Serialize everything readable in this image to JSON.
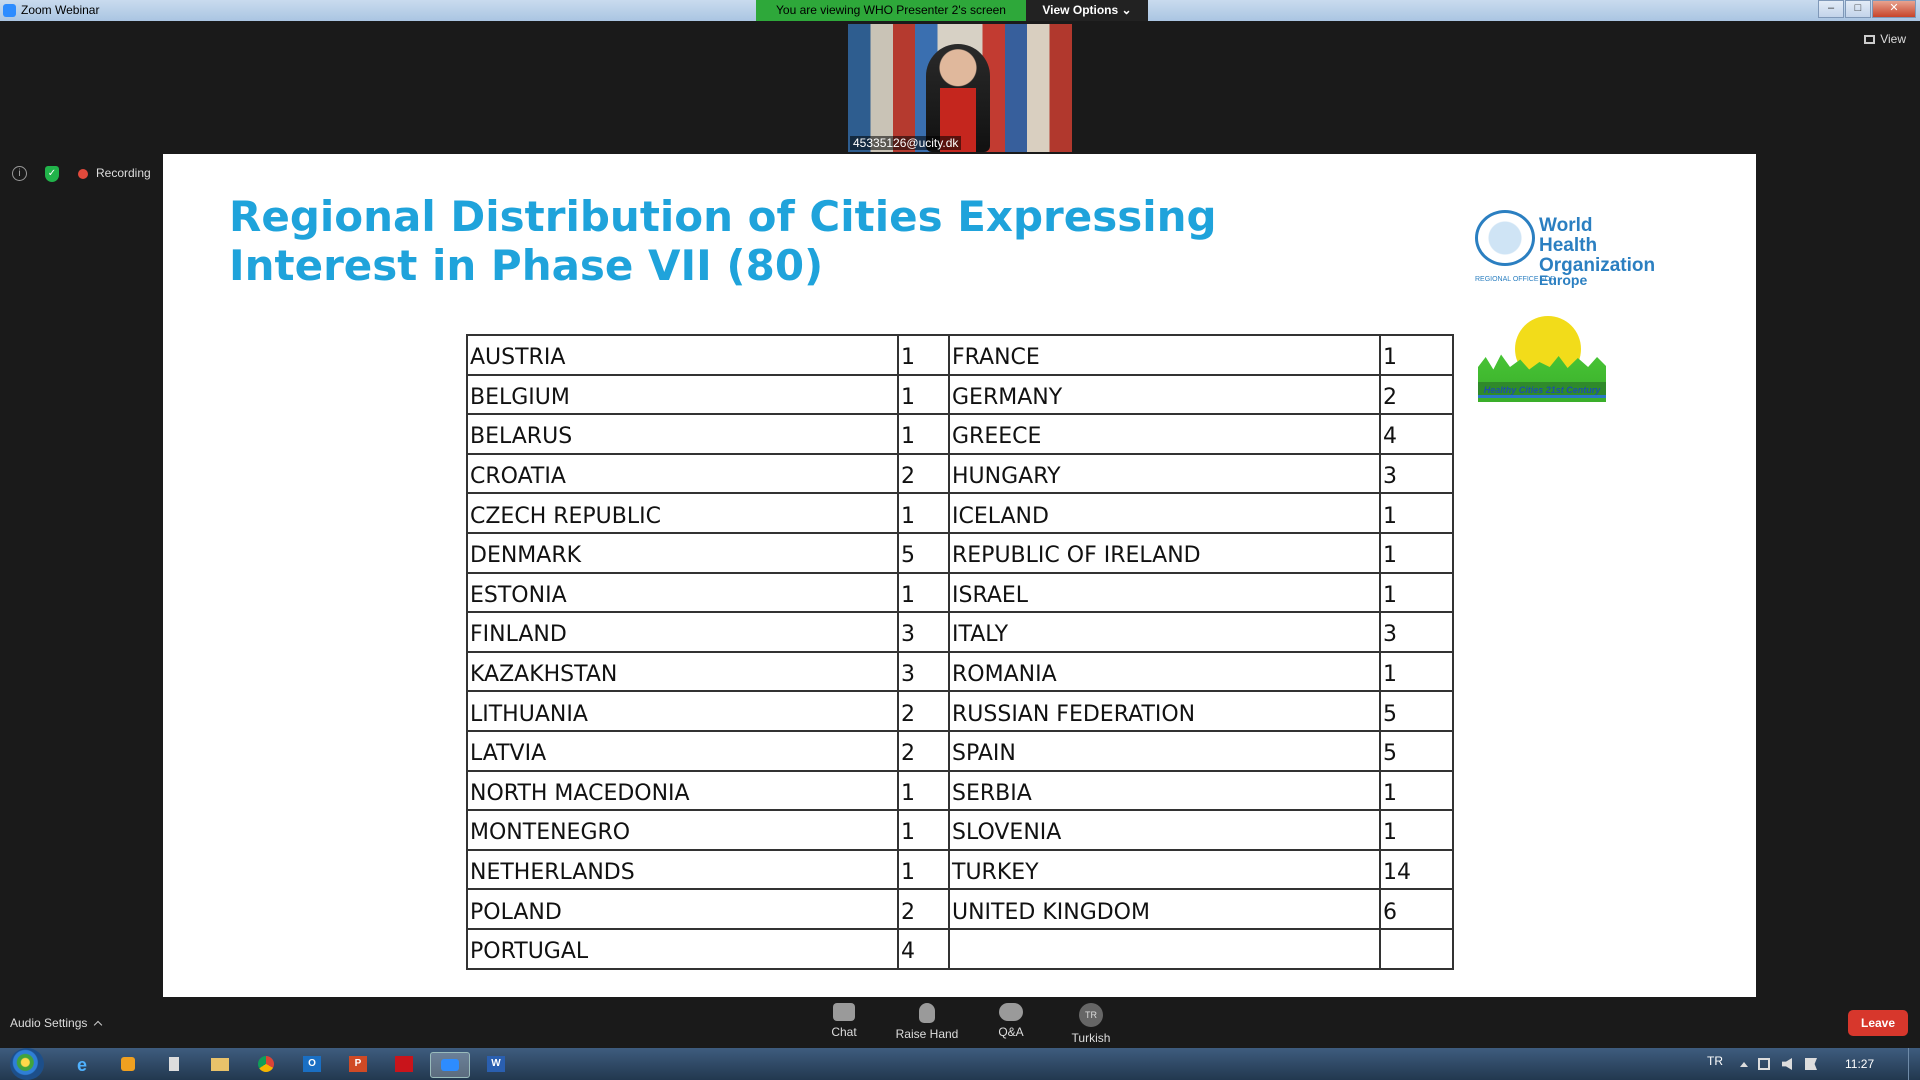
{
  "window": {
    "title": "Zoom Webinar",
    "share_banner": "You are viewing WHO Presenter 2's screen",
    "view_options": "View Options",
    "view_label": "View"
  },
  "video": {
    "participant_id": "45335126@ucity.dk"
  },
  "status": {
    "recording": "Recording"
  },
  "slide": {
    "title_line1": "Regional Distribution of Cities Expressing",
    "title_line2": "Interest in Phase VII (80)",
    "who_logo": {
      "name_line1": "World Health",
      "name_line2": "Organization",
      "sub": "REGIONAL OFFICE FOR",
      "region": "Europe"
    },
    "healthy_cities_logo": {
      "caption": "Healthy Cities 21st Century"
    },
    "table": [
      [
        "AUSTRIA",
        "1",
        "FRANCE",
        "1"
      ],
      [
        "BELGIUM",
        "1",
        "GERMANY",
        "2"
      ],
      [
        "BELARUS",
        "1",
        "GREECE",
        "4"
      ],
      [
        "CROATIA",
        "2",
        "HUNGARY",
        "3"
      ],
      [
        "CZECH REPUBLIC",
        "1",
        "ICELAND",
        "1"
      ],
      [
        "DENMARK",
        "5",
        "REPUBLIC OF IRELAND",
        "1"
      ],
      [
        "ESTONIA",
        "1",
        "ISRAEL",
        "1"
      ],
      [
        "FINLAND",
        "3",
        "ITALY",
        "3"
      ],
      [
        "KAZAKHSTAN",
        "3",
        "ROMANIA",
        "1"
      ],
      [
        "LITHUANIA",
        "2",
        "RUSSIAN FEDERATION",
        "5"
      ],
      [
        "LATVIA",
        "2",
        "SPAIN",
        "5"
      ],
      [
        "NORTH MACEDONIA",
        "1",
        "SERBIA",
        "1"
      ],
      [
        "MONTENEGRO",
        "1",
        "SLOVENIA",
        "1"
      ],
      [
        "NETHERLANDS",
        "1",
        "TURKEY",
        "14"
      ],
      [
        "POLAND",
        "2",
        "UNITED KINGDOM",
        "6"
      ],
      [
        "PORTUGAL",
        "4",
        "",
        ""
      ]
    ]
  },
  "toolbar": {
    "audio_settings": "Audio Settings",
    "chat": "Chat",
    "raise_hand": "Raise Hand",
    "qa": "Q&A",
    "language": "Turkish",
    "language_code": "TR",
    "leave": "Leave"
  },
  "taskbar": {
    "input_language": "TR",
    "clock": "11:27"
  },
  "colors": {
    "title_blue": "#1fa3db",
    "share_green": "#2ea83a",
    "leave_red": "#d7372c",
    "who_blue": "#2b7fc1"
  }
}
